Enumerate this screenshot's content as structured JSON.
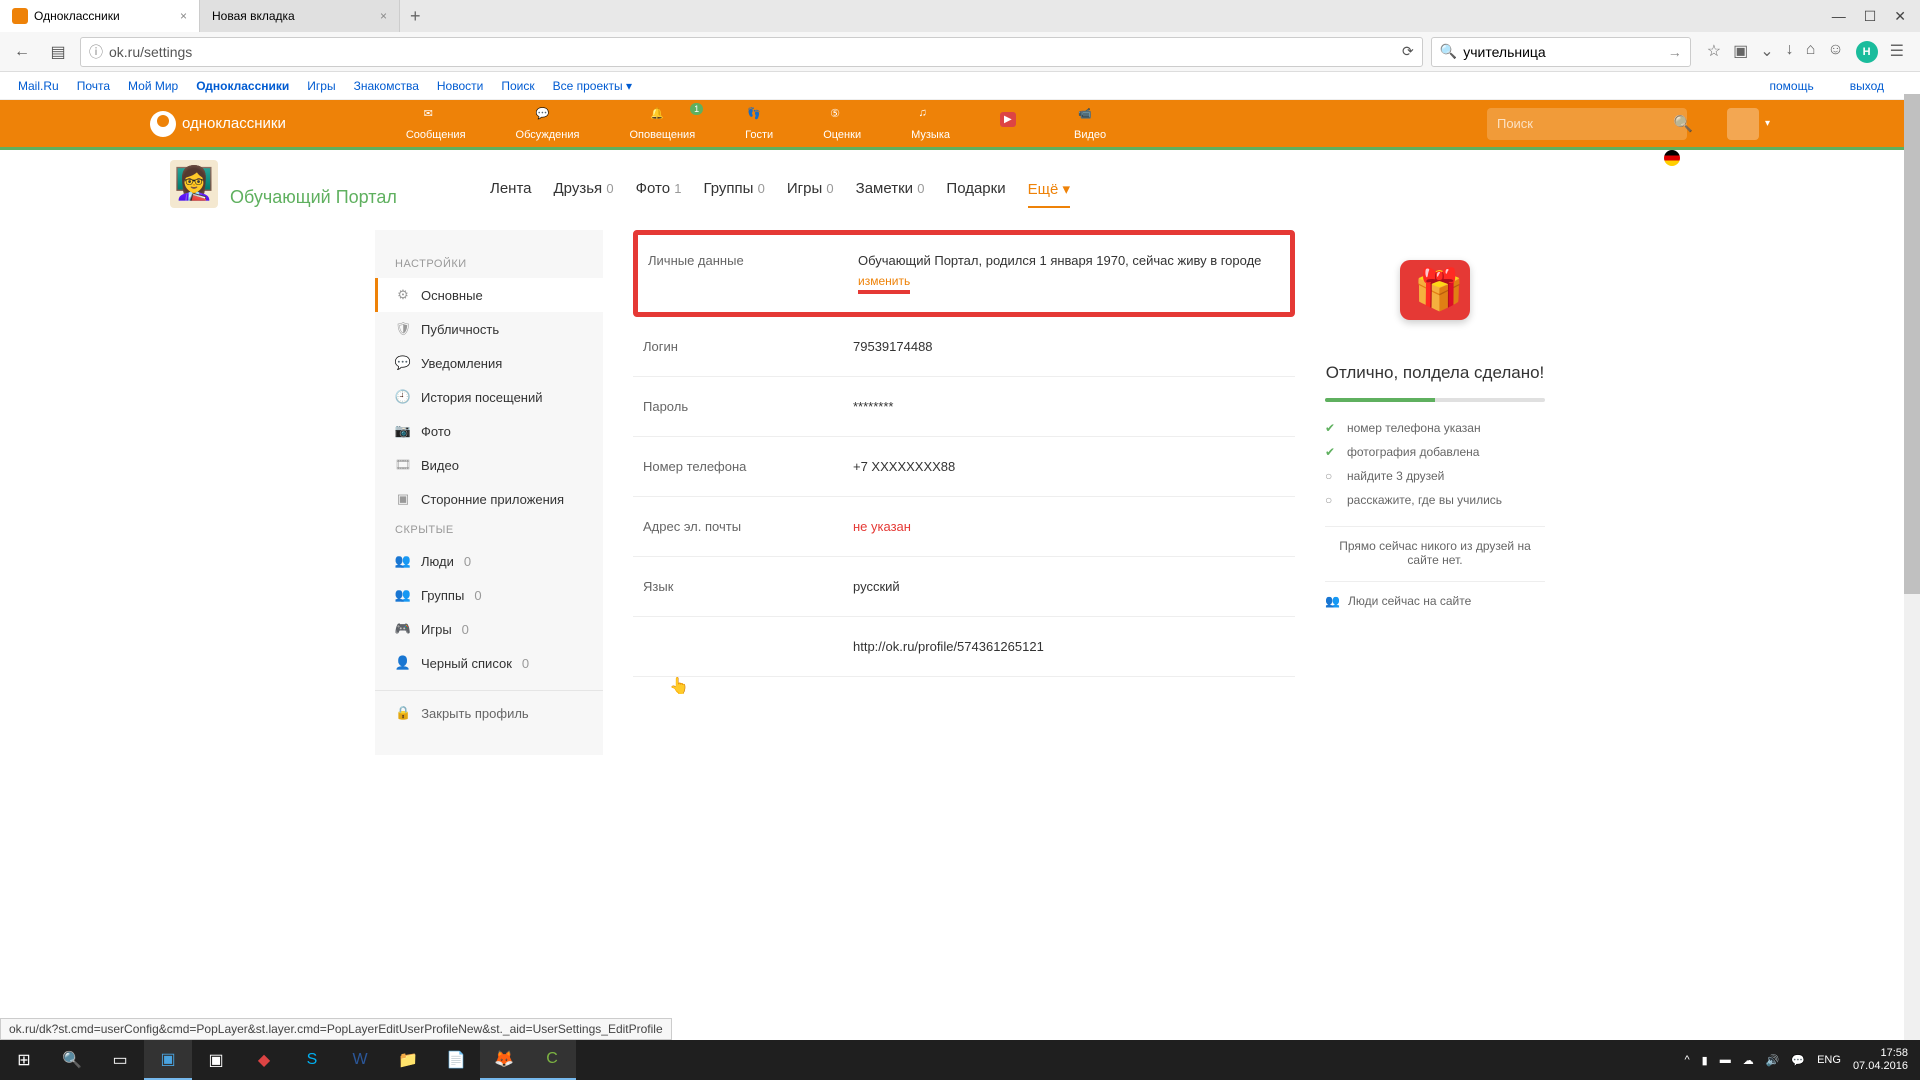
{
  "browser": {
    "tabs": [
      {
        "title": "Одноклассники",
        "active": true
      },
      {
        "title": "Новая вкладка",
        "active": false
      }
    ],
    "url": "ok.ru/settings",
    "search_value": "учительница"
  },
  "mailru_bar": {
    "links": [
      "Mail.Ru",
      "Почта",
      "Мой Мир",
      "Одноклассники",
      "Игры",
      "Знакомства",
      "Новости",
      "Поиск",
      "Все проекты"
    ],
    "active": "Одноклассники",
    "right": [
      "помощь",
      "выход"
    ]
  },
  "ok_header": {
    "logo": "одноклассники",
    "nav": [
      {
        "label": "Сообщения"
      },
      {
        "label": "Обсуждения"
      },
      {
        "label": "Оповещения",
        "badge": "1"
      },
      {
        "label": "Гости"
      },
      {
        "label": "Оценки"
      },
      {
        "label": "Музыка"
      },
      {
        "label": "Видео"
      }
    ],
    "search_placeholder": "Поиск"
  },
  "profile": {
    "name": "Обучающий Портал",
    "tabs": [
      {
        "label": "Лента"
      },
      {
        "label": "Друзья",
        "count": "0"
      },
      {
        "label": "Фото",
        "count": "1"
      },
      {
        "label": "Группы",
        "count": "0"
      },
      {
        "label": "Игры",
        "count": "0"
      },
      {
        "label": "Заметки",
        "count": "0"
      },
      {
        "label": "Подарки"
      },
      {
        "label": "Ещё ▾",
        "active": true
      }
    ]
  },
  "sidebar": {
    "heading1": "НАСТРОЙКИ",
    "items1": [
      {
        "label": "Основные",
        "active": true,
        "icon": "⚙"
      },
      {
        "label": "Публичность",
        "icon": "🛡"
      },
      {
        "label": "Уведомления",
        "icon": "💬"
      },
      {
        "label": "История посещений",
        "icon": "🕘"
      },
      {
        "label": "Фото",
        "icon": "📷"
      },
      {
        "label": "Видео",
        "icon": "🎞"
      },
      {
        "label": "Сторонние приложения",
        "icon": "▣"
      }
    ],
    "heading2": "СКРЫТЫЕ",
    "items2": [
      {
        "label": "Люди",
        "count": "0",
        "icon": "👥"
      },
      {
        "label": "Группы",
        "count": "0",
        "icon": "👥"
      },
      {
        "label": "Игры",
        "count": "0",
        "icon": "🎮"
      },
      {
        "label": "Черный список",
        "count": "0",
        "icon": "👤"
      }
    ],
    "close": "Закрыть профиль"
  },
  "settings": {
    "rows": [
      {
        "label": "Личные данные",
        "value": "Обучающий Портал, родился 1 января 1970, сейчас живу в городе",
        "change": "изменить",
        "highlighted": true
      },
      {
        "label": "Логин",
        "value": "79539174488"
      },
      {
        "label": "Пароль",
        "value": "********"
      },
      {
        "label": "Номер телефона",
        "value": "+7 XXXXXXXX88"
      },
      {
        "label": "Адрес эл. почты",
        "value": "не указан",
        "warn": true
      },
      {
        "label": "Язык",
        "value": "русский"
      },
      {
        "label": "",
        "value": "http://ok.ru/profile/574361265121"
      }
    ]
  },
  "widget": {
    "title": "Отлично, полдела сделано!",
    "checklist": [
      {
        "text": "номер телефона указан",
        "done": true
      },
      {
        "text": "фотография добавлена",
        "done": true
      },
      {
        "text": "найдите 3 друзей",
        "done": false
      },
      {
        "text": "расскажите, где вы учились",
        "done": false
      }
    ],
    "friends_note": "Прямо сейчас никого из друзей на сайте нет.",
    "friends_online": "Люди сейчас на сайте"
  },
  "status_link": "ok.ru/dk?st.cmd=userConfig&cmd=PopLayer&st.layer.cmd=PopLayerEditUserProfileNew&st._aid=UserSettings_EditProfile",
  "taskbar": {
    "lang": "ENG",
    "time": "17:58",
    "date": "07.04.2016"
  }
}
